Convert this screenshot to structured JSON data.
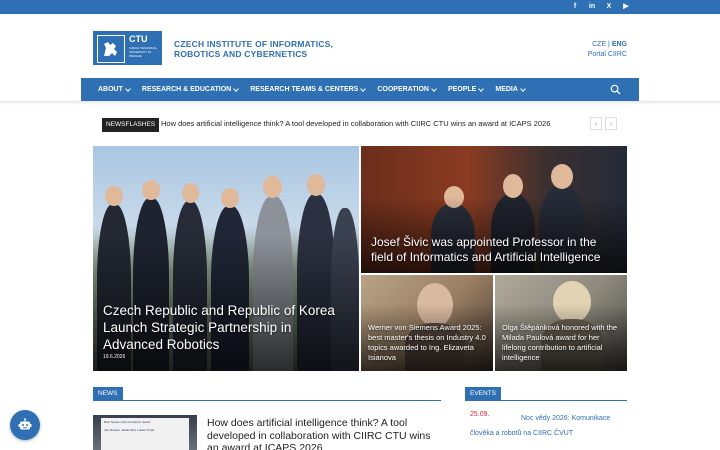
{
  "social": [
    "f",
    "in",
    "X",
    "▶"
  ],
  "logo": {
    "ctu": "CTU",
    "sub": "CZECH TECHNICAL UNIVERSITY IN PRAGUE"
  },
  "institute": {
    "line1": "CZECH INSTITUTE OF INFORMATICS,",
    "line2": "ROBOTICS AND CYBERNETICS"
  },
  "lang": {
    "cze": "CZE",
    "sep": " | ",
    "eng": "ENG",
    "portal": "Portal CIIRC"
  },
  "nav": [
    {
      "label": "ABOUT"
    },
    {
      "label": "RESEARCH & EDUCATION"
    },
    {
      "label": "RESEARCH TEAMS & CENTERS"
    },
    {
      "label": "COOPERATION"
    },
    {
      "label": "PEOPLE"
    },
    {
      "label": "MEDIA"
    }
  ],
  "ticker": {
    "label": "NEWSFLASHES",
    "text": "How does artificial intelligence think? A tool developed in collaboration with CIIRC CTU wins an award at ICAPS 2026",
    "prev": "‹",
    "next": "›"
  },
  "featured": {
    "main": {
      "title": "Czech Republic and Republic of Korea Launch Strategic Partnership in Advanced Robotics",
      "date": "19.6.2026"
    },
    "top_right": {
      "title": "Josef Šivic was appointed Professor in the field of Informatics and Artificial Intelligence"
    },
    "bottom_left": {
      "title": "Werner von Siemens Award 2025: best master's thesis on Industry 4.0 topics awarded to Ing. Elizaveta Isianova"
    },
    "bottom_right": {
      "title": "Olga Štěpánková honored with the Milada Paulová award for her lifelong contribution to artificial intelligence"
    }
  },
  "news": {
    "section": "NEWS",
    "thumb_caption": "Best System Demonstration Award",
    "thumb_names": "Jan Mrázek, Jakub Mull, Lukáš Chrpa",
    "title": "How does artificial intelligence think? A tool developed in collaboration with CIIRC CTU wins an award at ICAPS 2026"
  },
  "events": {
    "section": "EVENTS",
    "items": [
      {
        "date": "25.09.",
        "title": "Noc vědy 2026: Komunikace člověka a robotů na CIIRC ČVUT"
      }
    ]
  },
  "colors": {
    "brand": "#2f6fb3",
    "event_date": "#d0283a"
  },
  "icons": {
    "search": "search-icon",
    "chat": "chatbot-icon"
  }
}
